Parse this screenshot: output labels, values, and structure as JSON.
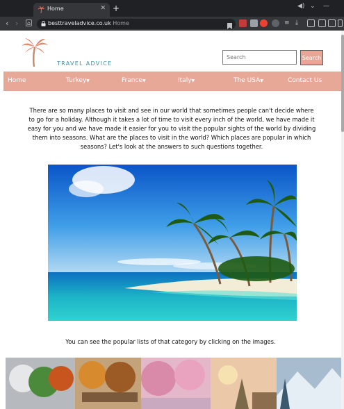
{
  "browser": {
    "tab_title": "Home",
    "url_host": "besttraveladvice.co.uk",
    "url_path": "Home"
  },
  "site": {
    "logo_text": "TRAVEL ADVICE",
    "search": {
      "placeholder": "Search",
      "button_label": "Search"
    },
    "nav": [
      "Home",
      "Turkey",
      "France",
      "Italy",
      "The USA",
      "Contact Us"
    ],
    "intro": "There are so many places to visit and see in our world that sometimes people can't decide where to go for a holiday. Although it takes a lot of time to visit every inch of the world, we have made it easy for you and we have made it easier for you to visit the popular sights of the world by dividing them into seasons. What are the places to visit in the world? Which places are popular in which seasons? Let's look at the answers to such questions together.",
    "caption": "You can see the popular lists of that category by clicking on the images."
  },
  "colors": {
    "nav_bg": "#e8a898",
    "button_bg": "#e8a796",
    "logo_text": "#3c8fa3"
  }
}
